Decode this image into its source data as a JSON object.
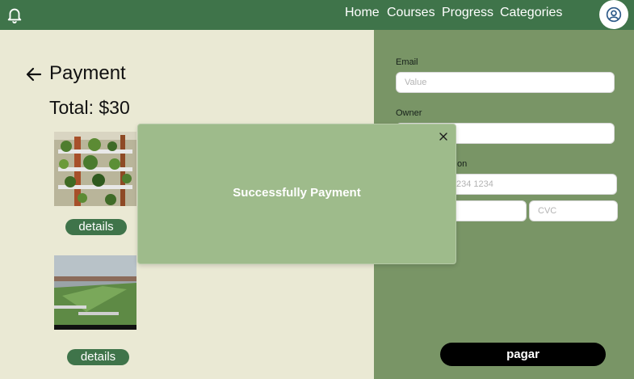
{
  "nav": {
    "home": "Home",
    "courses": "Courses",
    "progress": "Progress",
    "categories": "Categories"
  },
  "icons": {
    "notification": "bell-icon",
    "profile": "user-circle-icon",
    "back": "arrow-left-icon",
    "close": "close-icon"
  },
  "payment": {
    "title": "Payment",
    "total": "Total: $30",
    "details_label": "details"
  },
  "form": {
    "email_label": "Email",
    "email_placeholder": "Value",
    "owner_label": "Owner",
    "owner_value": "",
    "card_label_visible": "on",
    "card_placeholder_visible": "234 1234",
    "expiry_value": "",
    "cvc_placeholder": "CVC",
    "pay_label": "pagar"
  },
  "modal": {
    "message": "Successfully Payment"
  },
  "colors": {
    "nav_green": "#3f744a",
    "page_bg": "#eae9d4",
    "panel_green": "#799566",
    "modal_green": "#9ebb8b"
  }
}
